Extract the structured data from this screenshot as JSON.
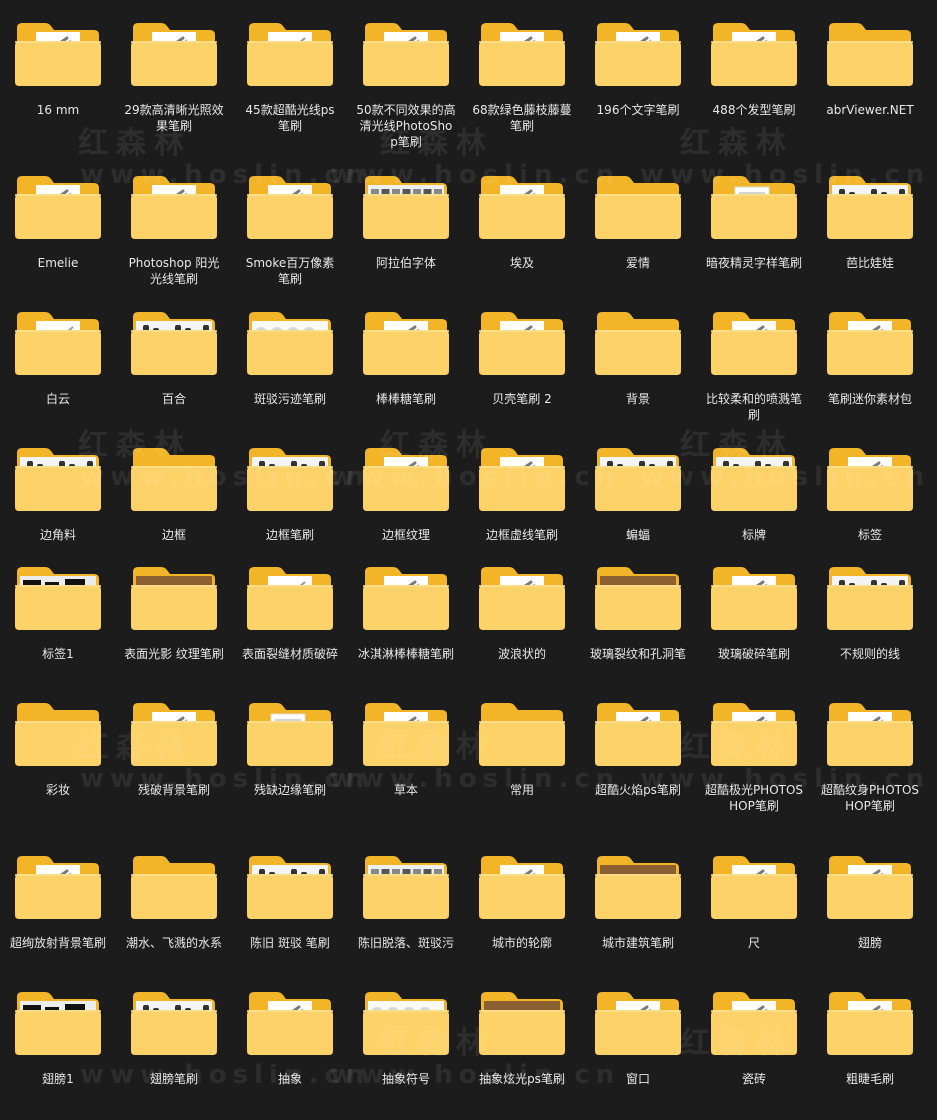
{
  "folders": [
    {
      "name": "16 mm",
      "thumb": "brush"
    },
    {
      "name": "29款高清晰光照效果笔刷",
      "thumb": "brush"
    },
    {
      "name": "45款超酷光线ps笔刷",
      "thumb": "green"
    },
    {
      "name": "50款不同效果的高清光线PhotoShop笔刷",
      "thumb": "brush"
    },
    {
      "name": "68款绿色藤枝藤蔓笔刷",
      "thumb": "brush"
    },
    {
      "name": "196个文字笔刷",
      "thumb": "brush"
    },
    {
      "name": "488个发型笔刷",
      "thumb": "brush"
    },
    {
      "name": "abrViewer.NET",
      "thumb": "none"
    },
    {
      "name": "Emelie",
      "thumb": "brush"
    },
    {
      "name": "Photoshop 阳光光线笔刷",
      "thumb": "brush"
    },
    {
      "name": "Smoke百万像素笔刷",
      "thumb": "brush"
    },
    {
      "name": "阿拉伯字体",
      "thumb": "swatches"
    },
    {
      "name": "埃及",
      "thumb": "brush"
    },
    {
      "name": "爱情",
      "thumb": "none"
    },
    {
      "name": "暗夜精灵字样笔刷",
      "thumb": "doc"
    },
    {
      "name": "芭比娃娃",
      "thumb": "figures"
    },
    {
      "name": "白云",
      "thumb": "green"
    },
    {
      "name": "百合",
      "thumb": "figures"
    },
    {
      "name": "斑驳污迹笔刷",
      "thumb": "blur"
    },
    {
      "name": "棒棒糖笔刷",
      "thumb": "brush"
    },
    {
      "name": "贝壳笔刷 2",
      "thumb": "brush"
    },
    {
      "name": "背景",
      "thumb": "none"
    },
    {
      "name": "比较柔和的喷溅笔刷",
      "thumb": "brush"
    },
    {
      "name": "笔刷迷你素材包",
      "thumb": "brush"
    },
    {
      "name": "边角料",
      "thumb": "figures"
    },
    {
      "name": "边框",
      "thumb": "none"
    },
    {
      "name": "边框笔刷",
      "thumb": "figures"
    },
    {
      "name": "边框纹理",
      "thumb": "brush"
    },
    {
      "name": "边框虚线笔刷",
      "thumb": "brush"
    },
    {
      "name": "蝙蝠",
      "thumb": "figures"
    },
    {
      "name": "标牌",
      "thumb": "figures"
    },
    {
      "name": "标签",
      "thumb": "brush"
    },
    {
      "name": "标签1",
      "thumb": "dark"
    },
    {
      "name": "表面光影 纹理笔刷",
      "thumb": "photo"
    },
    {
      "name": "表面裂缝材质破碎",
      "thumb": "green"
    },
    {
      "name": "冰淇淋棒棒糖笔刷",
      "thumb": "brush"
    },
    {
      "name": "波浪状的",
      "thumb": "brush"
    },
    {
      "name": "玻璃裂纹和孔洞笔",
      "thumb": "photo"
    },
    {
      "name": "玻璃破碎笔刷",
      "thumb": "brush"
    },
    {
      "name": "不规则的线",
      "thumb": "figures"
    },
    {
      "name": "彩妆",
      "thumb": "none"
    },
    {
      "name": "残破背景笔刷",
      "thumb": "brush"
    },
    {
      "name": "残缺边缘笔刷",
      "thumb": "doc"
    },
    {
      "name": "草本",
      "thumb": "brush"
    },
    {
      "name": "常用",
      "thumb": "none"
    },
    {
      "name": "超酷火焰ps笔刷",
      "thumb": "brush"
    },
    {
      "name": "超酷极光PHOTOSHOP笔刷",
      "thumb": "brush"
    },
    {
      "name": "超酷纹身PHOTOSHOP笔刷",
      "thumb": "brush"
    },
    {
      "name": "超绚放射背景笔刷",
      "thumb": "brush"
    },
    {
      "name": "潮水、飞溅的水系",
      "thumb": "none"
    },
    {
      "name": "陈旧 斑驳 笔刷",
      "thumb": "figures"
    },
    {
      "name": "陈旧脱落、斑驳污",
      "thumb": "swatches"
    },
    {
      "name": "城市的轮廓",
      "thumb": "brush"
    },
    {
      "name": "城市建筑笔刷",
      "thumb": "photo"
    },
    {
      "name": "尺",
      "thumb": "brush"
    },
    {
      "name": "翅膀",
      "thumb": "brush"
    },
    {
      "name": "翅膀1",
      "thumb": "dark"
    },
    {
      "name": "翅膀笔刷",
      "thumb": "figures"
    },
    {
      "name": "抽象",
      "thumb": "brush"
    },
    {
      "name": "抽象符号",
      "thumb": "blur"
    },
    {
      "name": "抽象炫光ps笔刷",
      "thumb": "photo"
    },
    {
      "name": "窗口",
      "thumb": "brush"
    },
    {
      "name": "瓷砖",
      "thumb": "brush"
    },
    {
      "name": "粗睫毛刷",
      "thumb": "brush"
    }
  ],
  "watermark": {
    "text": "红森林",
    "url": "www.hoslin.cn"
  },
  "colors": {
    "background": "#1c1c1c",
    "folder_back": "#f2b528",
    "folder_front": "#fdd268",
    "label": "#e8e8e8"
  }
}
